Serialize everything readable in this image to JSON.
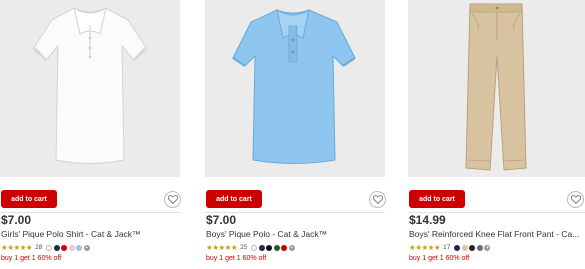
{
  "products": [
    {
      "price": "$7.00",
      "title": "Girls' Pique Polo Shirt - Cat & Jack™",
      "rating": 4.5,
      "stars": "★★★★★",
      "review_count": "28",
      "add_to_cart": "add to cart",
      "promo": "buy 1 get 1 60% off",
      "swatches": [
        "#ffffff",
        "#1b2a4a",
        "#cc0000",
        "#f2c6d4",
        "#9ec3e8"
      ],
      "more_colors": "+",
      "image": "white-girls-polo-shirt"
    },
    {
      "price": "$7.00",
      "title": "Boys' Pique Polo - Cat & Jack™",
      "rating": 4.5,
      "stars": "★★★★★",
      "review_count": "25",
      "add_to_cart": "add to cart",
      "promo": "buy 1 get 1 60% off",
      "swatches": [
        "#ffffff",
        "#1b2a4a",
        "#0c0c0c",
        "#1f5e2c",
        "#cc0000"
      ],
      "more_colors": "+",
      "image": "light-blue-boys-polo-shirt"
    },
    {
      "price": "$14.99",
      "title": "Boys' Reinforced Knee Flat Front Pant - Ca...",
      "rating": 4.5,
      "stars": "★★★★★",
      "review_count": "17",
      "add_to_cart": "add to cart",
      "promo": "buy 1 get 1 60% off",
      "swatches": [
        "#1b2a4a",
        "#d9c6a2",
        "#222222",
        "#6e6e6e"
      ],
      "more_colors": "+",
      "image": "khaki-flat-front-pants"
    }
  ],
  "colors": {
    "accent": "#cc0000",
    "image_bg": "#ebebeb",
    "star": "#c8a400",
    "text": "#333333"
  }
}
